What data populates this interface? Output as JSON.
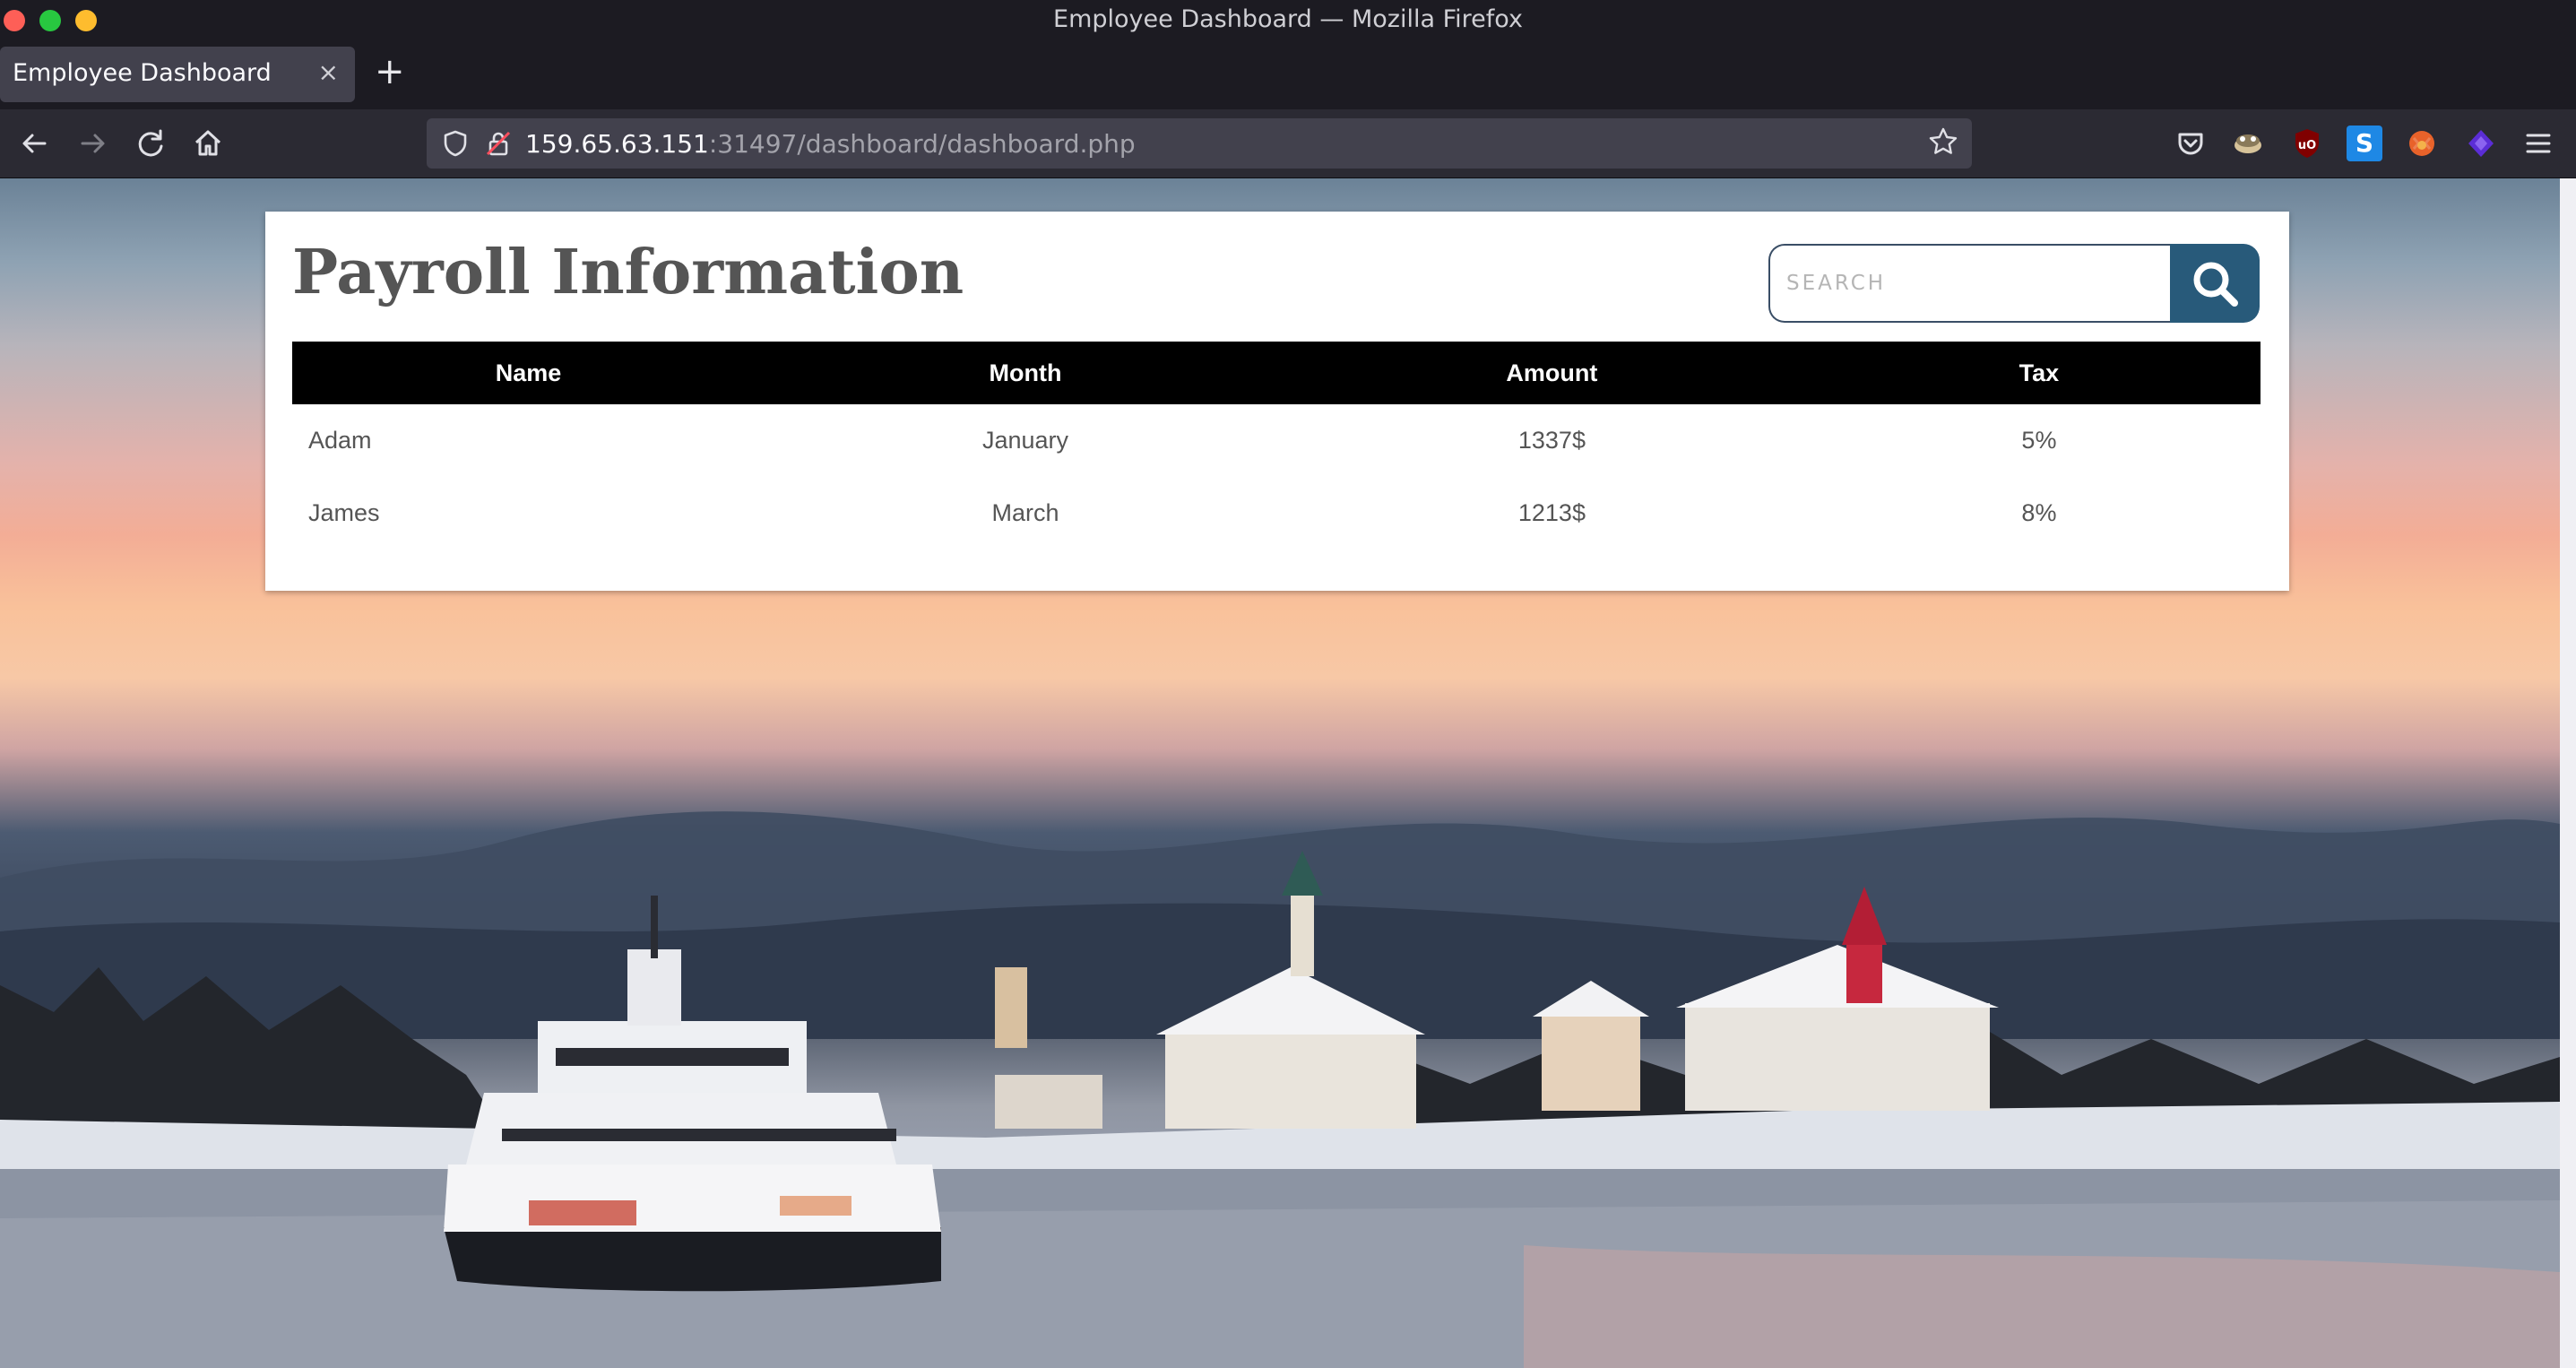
{
  "window": {
    "title": "Employee Dashboard — Mozilla Firefox"
  },
  "tabs": [
    {
      "label": "Employee Dashboard",
      "close": "×"
    }
  ],
  "new_tab": "+",
  "address_bar": {
    "host": "159.65.63.151",
    "rest": ":31497/dashboard/dashboard.php"
  },
  "extensions": {
    "s_label": "S"
  },
  "page": {
    "title": "Payroll Information",
    "search": {
      "placeholder": "SEARCH"
    },
    "table": {
      "headers": [
        "Name",
        "Month",
        "Amount",
        "Tax"
      ],
      "rows": [
        [
          "Adam",
          "January",
          "1337$",
          "5%"
        ],
        [
          "James",
          "March",
          "1213$",
          "8%"
        ]
      ]
    }
  },
  "colors": {
    "chrome_dark": "#1c1b22",
    "toolbar": "#2b2a33",
    "tab_active": "#42414d",
    "search_button": "#285a7a",
    "table_header": "#000000"
  }
}
